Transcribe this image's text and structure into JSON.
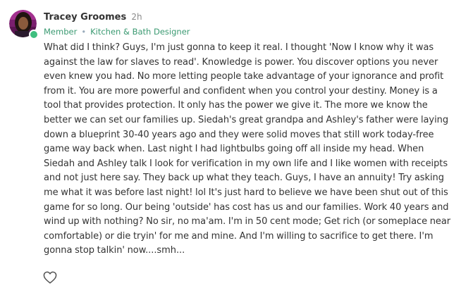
{
  "author": {
    "name": "Tracey Groomes",
    "time_ago": "2h",
    "role": "Member",
    "separator": "•",
    "title": "Kitchen & Bath Designer",
    "online": true
  },
  "post": {
    "body": "What did I think? Guys, I'm just gonna to keep it real.  I thought 'Now I know why it was against the law for slaves to read'.  Knowledge is power. You discover options you never even knew you had. No more letting people take advantage of your ignorance and profit from it. You are more powerful and confident when you control your destiny. Money is a tool that provides protection. It only has the power we give it. The more we know the better we can set our families up. Siedah's great grandpa and Ashley's father were laying down a blueprint 30-40 years ago and they were solid moves that still work today-free game way back when. Last night I had lightbulbs going off all inside my head. When Siedah and Ashley talk I look for verification in my own life and I like women with receipts and not just here say. They back up what they teach. Guys, I have an annuity! Try asking me what it was before last night! lol It's just hard to believe we have been shut out of this game for so long. Our being 'outside' has cost has us and our families. Work 40 years and wind up with nothing? No sir, no ma'am.  I'm in 50 cent mode; Get rich (or someplace near comfortable) or die tryin' for me and mine. And I'm willing to sacrifice to get there. I'm gonna stop talkin' now....smh..."
  },
  "actions": {
    "like_icon": "heart-outline-icon"
  },
  "colors": {
    "accent": "#3b9a72",
    "online": "#3fbf7f",
    "text": "#333333",
    "muted": "#8a8a8a"
  }
}
